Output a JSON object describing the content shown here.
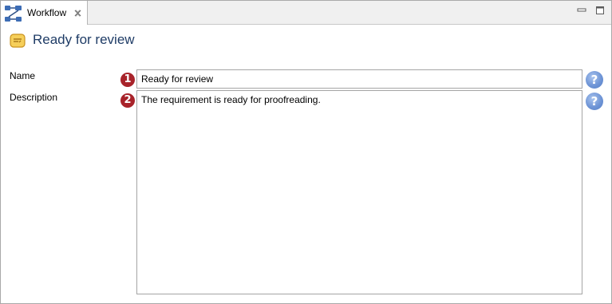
{
  "tab": {
    "label": "Workflow",
    "icon": "workflow-icon",
    "close_icon": "close-icon"
  },
  "window_controls": {
    "minimize_icon": "minimize-icon",
    "maximize_icon": "maximize-icon"
  },
  "header": {
    "title": "Ready for review",
    "icon": "status-state-icon"
  },
  "form": {
    "name": {
      "label": "Name",
      "badge": "1",
      "value": "Ready for review",
      "help": "?"
    },
    "description": {
      "label": "Description",
      "badge": "2",
      "value": "The requirement is ready for proofreading.",
      "help": "?"
    }
  },
  "colors": {
    "badge": "#a8232a",
    "help": "#6f95d6",
    "title": "#1f3c66"
  }
}
